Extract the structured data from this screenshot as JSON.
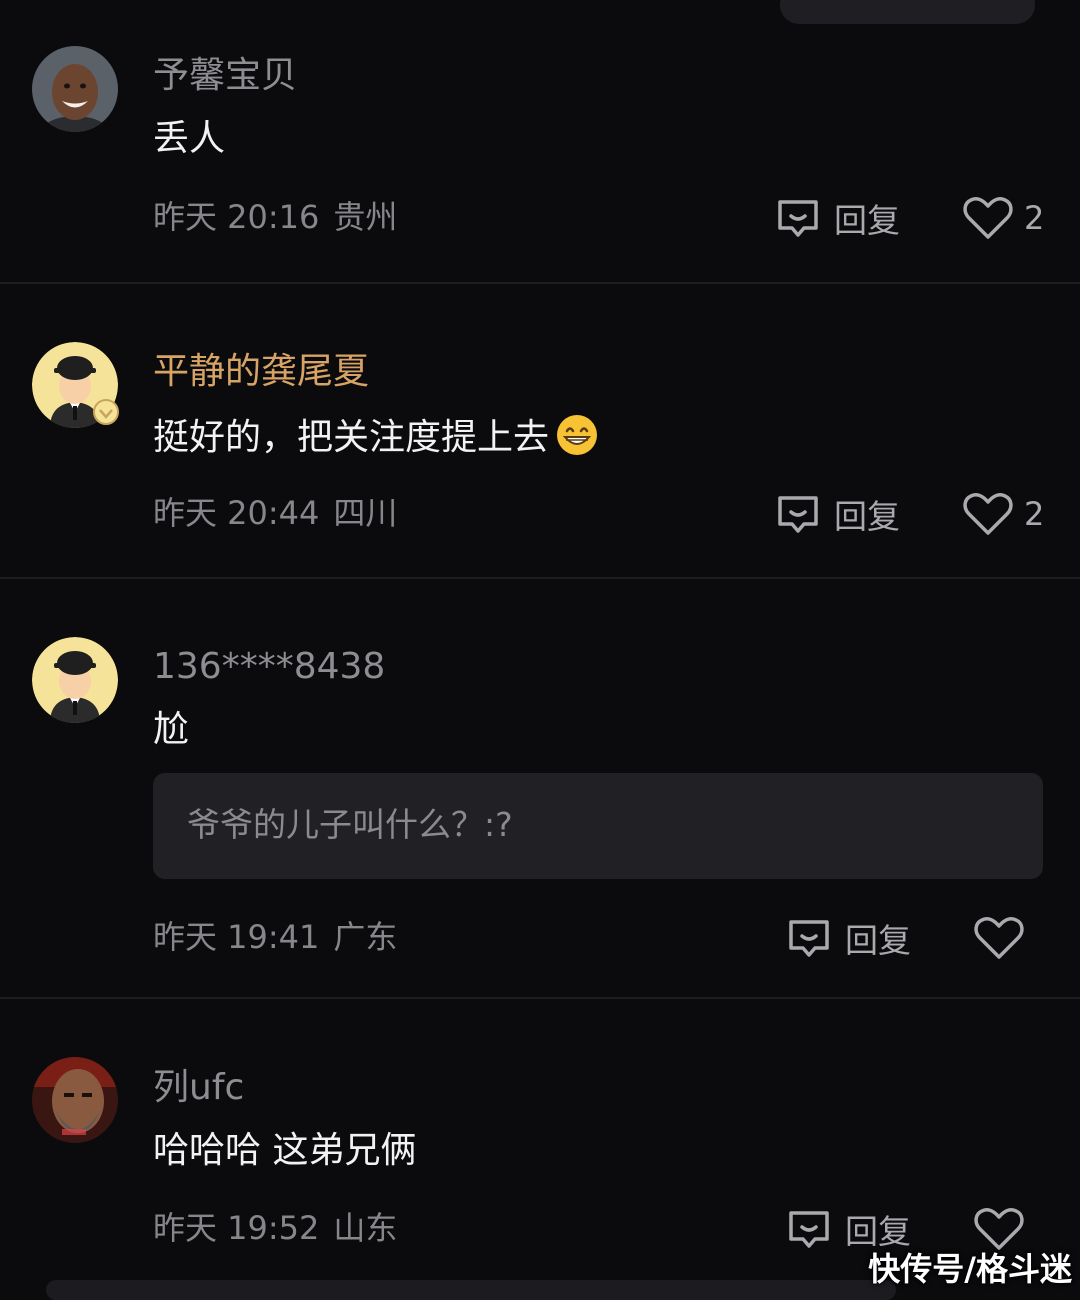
{
  "reply_label": "回复",
  "watermark": "快传号/格斗迷",
  "colors": {
    "background": "#0b0b0e",
    "username_default": "#8d8d92",
    "username_vip": "#d7a466",
    "text": "#f2f2f2",
    "meta": "#86868b"
  },
  "comments": [
    {
      "username": "予馨宝贝",
      "text": "丢人",
      "time": "昨天 20:16",
      "location": "贵州",
      "likes": "2",
      "avatar": "smiling-man-avatar"
    },
    {
      "username": "平静的龚尾夏",
      "text": "挺好的，把关注度提上去",
      "emoji": "grinning-face-emoji",
      "time": "昨天 20:44",
      "location": "四川",
      "likes": "2",
      "avatar": "cartoon-bowler-hat-avatar",
      "verified": true
    },
    {
      "username": "136****8438",
      "text": "尬",
      "quote": "爷爷的儿子叫什么？:?",
      "time": "昨天 19:41",
      "location": "广东",
      "likes": "",
      "avatar": "cartoon-bowler-hat-avatar"
    },
    {
      "username": "列ufc",
      "text": "哈哈哈 这弟兄俩",
      "time": "昨天 19:52",
      "location": "山东",
      "likes": "",
      "avatar": "bearded-fighter-avatar"
    }
  ]
}
